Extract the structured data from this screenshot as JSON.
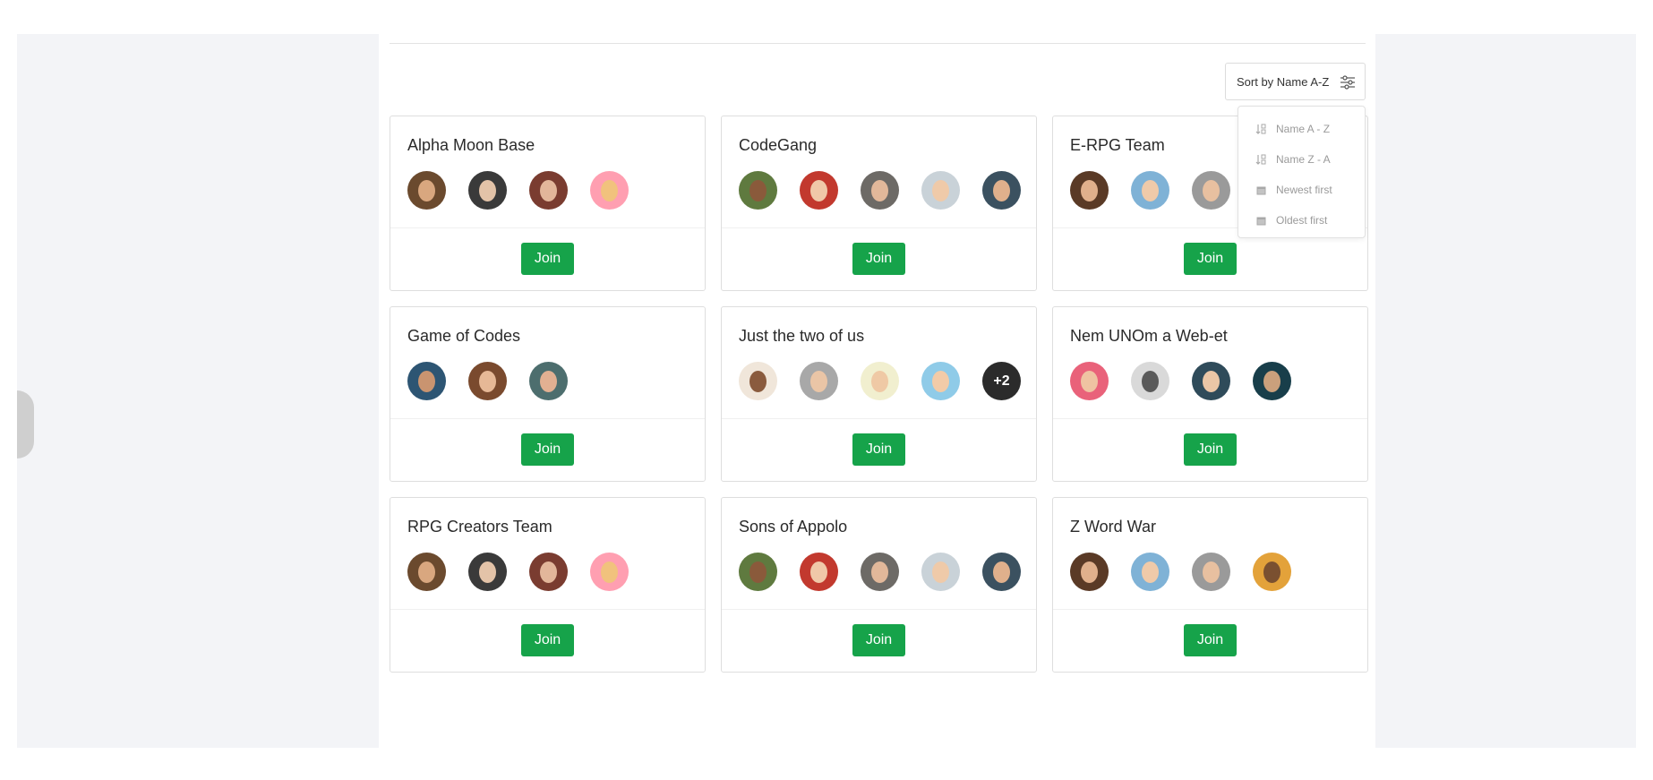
{
  "sort": {
    "button_label": "Sort by Name A-Z",
    "options": [
      {
        "label": "Name A - Z",
        "icon": "sort-az-icon"
      },
      {
        "label": "Name Z - A",
        "icon": "sort-za-icon"
      },
      {
        "label": "Newest first",
        "icon": "calendar-icon"
      },
      {
        "label": "Oldest first",
        "icon": "calendar-icon"
      }
    ]
  },
  "colors": {
    "join": "#16a34a",
    "background": "#f3f4f7"
  },
  "teams": [
    {
      "name": "Alpha Moon Base",
      "join_label": "Join",
      "avatars": [
        {
          "bg": "#6b4a2e",
          "face": "#d9a77f"
        },
        {
          "bg": "#3a3a3a",
          "face": "#e3c3a8"
        },
        {
          "bg": "#7a3c30",
          "face": "#e2b69a"
        },
        {
          "bg": "#ff9fb1",
          "face": "#f1c27d"
        }
      ]
    },
    {
      "name": "CodeGang",
      "join_label": "Join",
      "avatars": [
        {
          "bg": "#5f7a3f",
          "face": "#8a5a3b"
        },
        {
          "bg": "#c2392e",
          "face": "#f0c8a8"
        },
        {
          "bg": "#6d6a66",
          "face": "#e2b89a"
        },
        {
          "bg": "#c9d2d8",
          "face": "#efcaa9"
        },
        {
          "bg": "#3b5160",
          "face": "#e0b08c"
        }
      ]
    },
    {
      "name": "E-RPG Team",
      "join_label": "Join",
      "avatars": [
        {
          "bg": "#5a3a26",
          "face": "#e0b08c"
        },
        {
          "bg": "#7fb2d6",
          "face": "#efcaa9"
        },
        {
          "bg": "#9a9a9a",
          "face": "#e8c0a0"
        },
        {
          "bg": "#e3a23a",
          "face": "#efcaa9"
        }
      ]
    },
    {
      "name": "Game of Codes",
      "join_label": "Join",
      "avatars": [
        {
          "bg": "#2d5573",
          "face": "#c99470"
        },
        {
          "bg": "#7a4a2e",
          "face": "#e6b896"
        },
        {
          "bg": "#4d6e6e",
          "face": "#e2b092"
        }
      ]
    },
    {
      "name": "Just the two of us",
      "join_label": "Join",
      "more_label": "+2",
      "avatars": [
        {
          "bg": "#f0e6da",
          "face": "#8a5b3e"
        },
        {
          "bg": "#a8a8a8",
          "face": "#eac5a6"
        },
        {
          "bg": "#f1efcf",
          "face": "#efc9a5"
        },
        {
          "bg": "#8fcbe8",
          "face": "#f2cba8"
        }
      ]
    },
    {
      "name": "Nem UNOm a Web-et",
      "join_label": "Join",
      "avatars": [
        {
          "bg": "#e9627a",
          "face": "#efc3a2"
        },
        {
          "bg": "#d9d9d9",
          "face": "#5a5a5a"
        },
        {
          "bg": "#2f4b5a",
          "face": "#eac6a6"
        },
        {
          "bg": "#183e4a",
          "face": "#caa07c"
        }
      ]
    },
    {
      "name": "RPG Creators Team",
      "join_label": "Join",
      "avatars": [
        {
          "bg": "#6b4a2e",
          "face": "#d9a77f"
        },
        {
          "bg": "#3a3a3a",
          "face": "#e3c3a8"
        },
        {
          "bg": "#7a3c30",
          "face": "#e2b69a"
        },
        {
          "bg": "#ff9fb1",
          "face": "#f1c27d"
        }
      ]
    },
    {
      "name": "Sons of Appolo",
      "join_label": "Join",
      "avatars": [
        {
          "bg": "#5f7a3f",
          "face": "#8a5a3b"
        },
        {
          "bg": "#c2392e",
          "face": "#f0c8a8"
        },
        {
          "bg": "#6d6a66",
          "face": "#e2b89a"
        },
        {
          "bg": "#c9d2d8",
          "face": "#efcaa9"
        },
        {
          "bg": "#3b5160",
          "face": "#e0b08c"
        }
      ]
    },
    {
      "name": "Z Word War",
      "join_label": "Join",
      "avatars": [
        {
          "bg": "#5a3a26",
          "face": "#e0b08c"
        },
        {
          "bg": "#7fb2d6",
          "face": "#efcaa9"
        },
        {
          "bg": "#9a9a9a",
          "face": "#e8c0a0"
        },
        {
          "bg": "#e3a23a",
          "face": "#7a5030"
        }
      ]
    }
  ]
}
